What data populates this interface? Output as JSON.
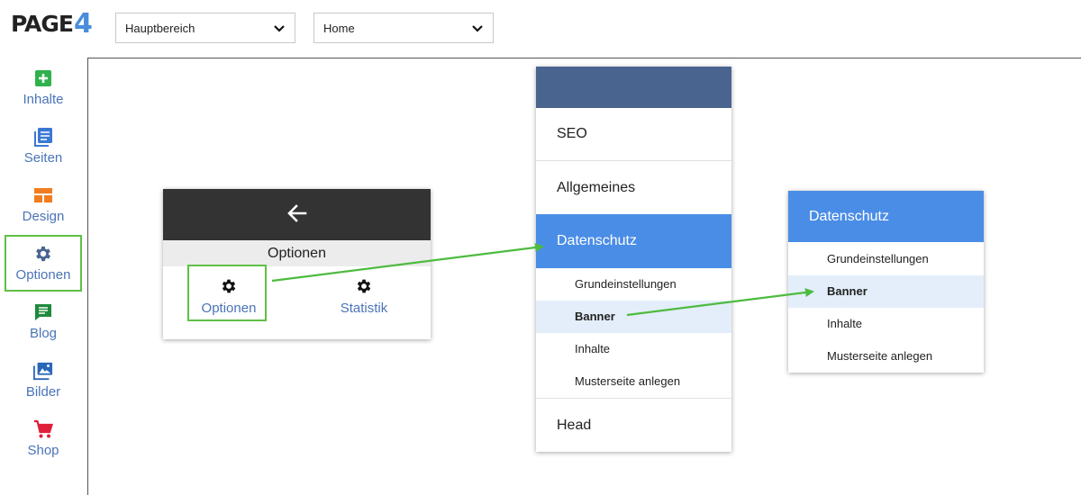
{
  "brand": {
    "logo_text": "PAGE",
    "logo_number": "4"
  },
  "topbar": {
    "area_select": {
      "value": "Hauptbereich"
    },
    "page_select": {
      "value": "Home"
    }
  },
  "sidebar": {
    "items": [
      {
        "label": "Inhalte",
        "icon": "plus-square-icon",
        "color": "#2fb24c"
      },
      {
        "label": "Seiten",
        "icon": "pages-icon",
        "color": "#3b78d6"
      },
      {
        "label": "Design",
        "icon": "layout-icon",
        "color": "#f07d21"
      },
      {
        "label": "Optionen",
        "icon": "gear-icon",
        "color": "#4a6490",
        "highlighted": true
      },
      {
        "label": "Blog",
        "icon": "blog-icon",
        "color": "#1f8a3c"
      },
      {
        "label": "Bilder",
        "icon": "images-icon",
        "color": "#2b67b8"
      },
      {
        "label": "Shop",
        "icon": "cart-icon",
        "color": "#e0203a"
      }
    ]
  },
  "options_panel": {
    "back_icon": "arrow-left-icon",
    "title": "Optionen",
    "items": [
      {
        "label": "Optionen",
        "icon": "gear-icon",
        "highlighted": true
      },
      {
        "label": "Statistik",
        "icon": "gear-icon"
      }
    ]
  },
  "settings_menu": {
    "items": [
      {
        "label": "SEO"
      },
      {
        "label": "Allgemeines"
      },
      {
        "label": "Datenschutz",
        "active": true
      },
      {
        "label": "Head"
      }
    ],
    "submenu": [
      {
        "label": "Grundeinstellungen"
      },
      {
        "label": "Banner",
        "highlighted": true
      },
      {
        "label": "Inhalte"
      },
      {
        "label": "Musterseite anlegen"
      }
    ]
  },
  "datenschutz_panel": {
    "title": "Datenschutz",
    "items": [
      {
        "label": "Grundeinstellungen"
      },
      {
        "label": "Banner",
        "highlighted": true
      },
      {
        "label": "Inhalte"
      },
      {
        "label": "Musterseite anlegen"
      }
    ]
  },
  "colors": {
    "accent_blue": "#4a8de6",
    "header_dark": "#333333",
    "header_navy": "#4a6490",
    "highlight_green": "#5fbf45",
    "hover_light": "#e3eefa"
  }
}
